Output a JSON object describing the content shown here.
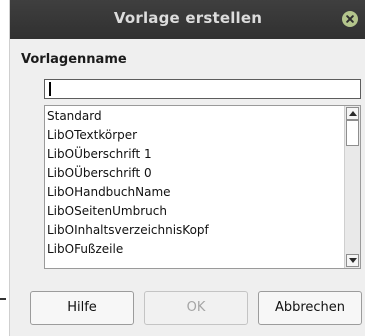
{
  "dialog": {
    "title": "Vorlage erstellen",
    "close_icon": "close-icon",
    "section_label": "Vorlagenname",
    "name_input": {
      "value": "",
      "placeholder": ""
    },
    "templates": [
      "Standard",
      "LibOTextkörper",
      "LibOÜberschrift 1",
      "LibOÜberschrift 0",
      "LibOHandbuchName",
      "LibOSeitenUmbruch",
      "LibOInhaltsverzeichnisKopf",
      "LibOFußzeile"
    ],
    "buttons": {
      "help": "Hilfe",
      "ok": "OK",
      "cancel": "Abbrechen"
    }
  },
  "colors": {
    "titlebar": "#353535",
    "dialog_background": "#efefef",
    "close_button": "#b4c58c"
  }
}
